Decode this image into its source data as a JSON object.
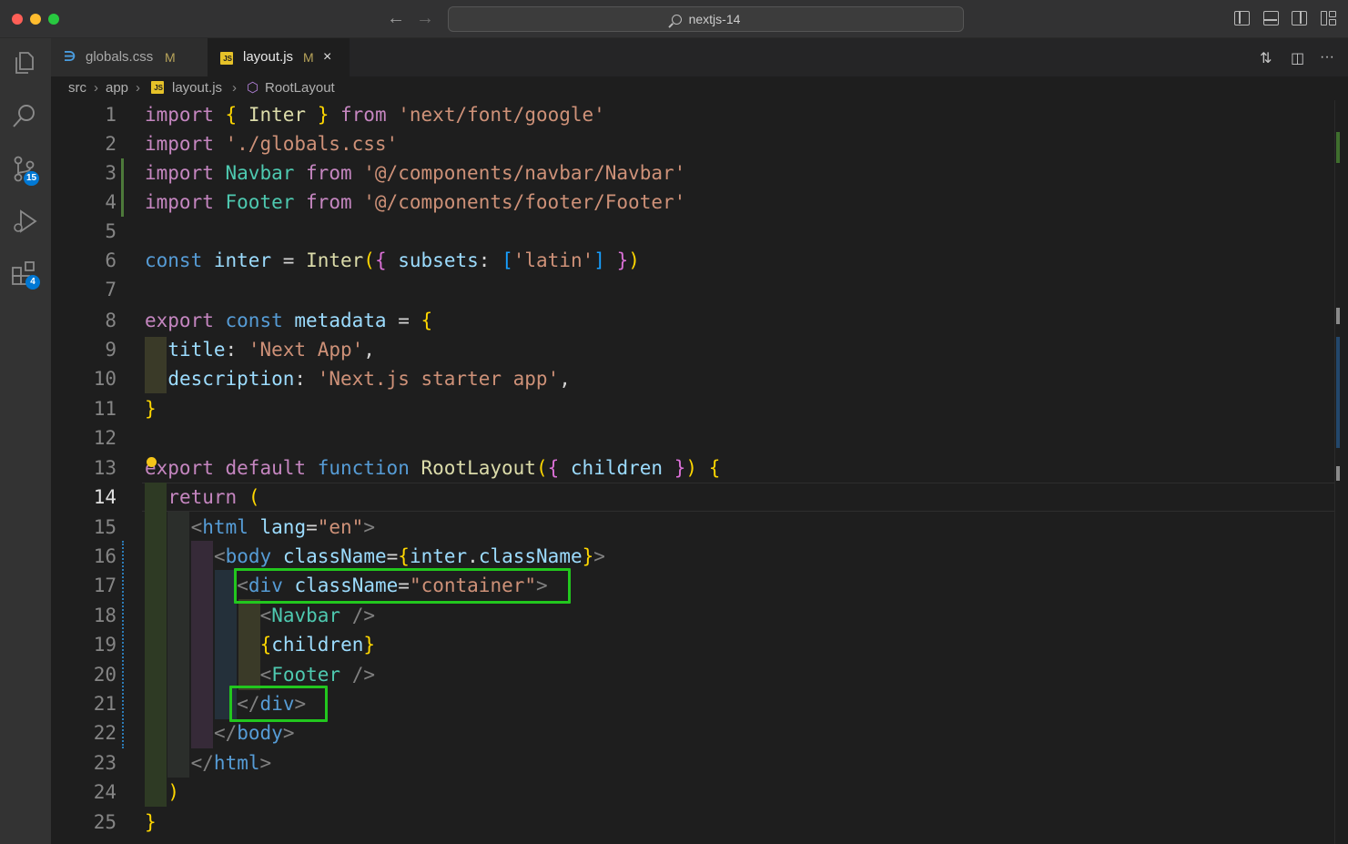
{
  "window": {
    "search_label": "nextjs-14"
  },
  "activity_bar": {
    "source_control_badge": "15",
    "extensions_badge": "4"
  },
  "tabs": [
    {
      "label": "globals.css",
      "status": "M"
    },
    {
      "label": "layout.js",
      "status": "M",
      "close": "×"
    }
  ],
  "breadcrumb": {
    "items": [
      "src",
      "app",
      "layout.js",
      "RootLayout"
    ]
  },
  "editor": {
    "active_line": 14,
    "line_numbers": [
      "1",
      "2",
      "3",
      "4",
      "5",
      "6",
      "7",
      "8",
      "9",
      "10",
      "11",
      "12",
      "13",
      "14",
      "15",
      "16",
      "17",
      "18",
      "19",
      "20",
      "21",
      "22",
      "23",
      "24",
      "25"
    ],
    "lines": [
      "import { Inter } from 'next/font/google'",
      "import './globals.css'",
      "import Navbar from '@/components/navbar/Navbar'",
      "import Footer from '@/components/footer/Footer'",
      "",
      "const inter = Inter({ subsets: ['latin'] })",
      "",
      "export const metadata = {",
      "  title: 'Next App',",
      "  description: 'Next.js starter app',",
      "}",
      "",
      "export default function RootLayout({ children }) {",
      "  return (",
      "    <html lang=\"en\">",
      "      <body className={inter.className}>",
      "        <div className=\"container\">",
      "          <Navbar />",
      "          {children}",
      "          <Footer />",
      "        </div>",
      "      </body>",
      "    </html>",
      "  )",
      "}"
    ]
  },
  "colors": {
    "highlight_box": "#22c71e",
    "keyword": "#c586c0",
    "storage": "#569cd6",
    "string": "#ce9178",
    "variable": "#9cdcfe",
    "function": "#dcdcaa",
    "component": "#4ec9b0"
  }
}
